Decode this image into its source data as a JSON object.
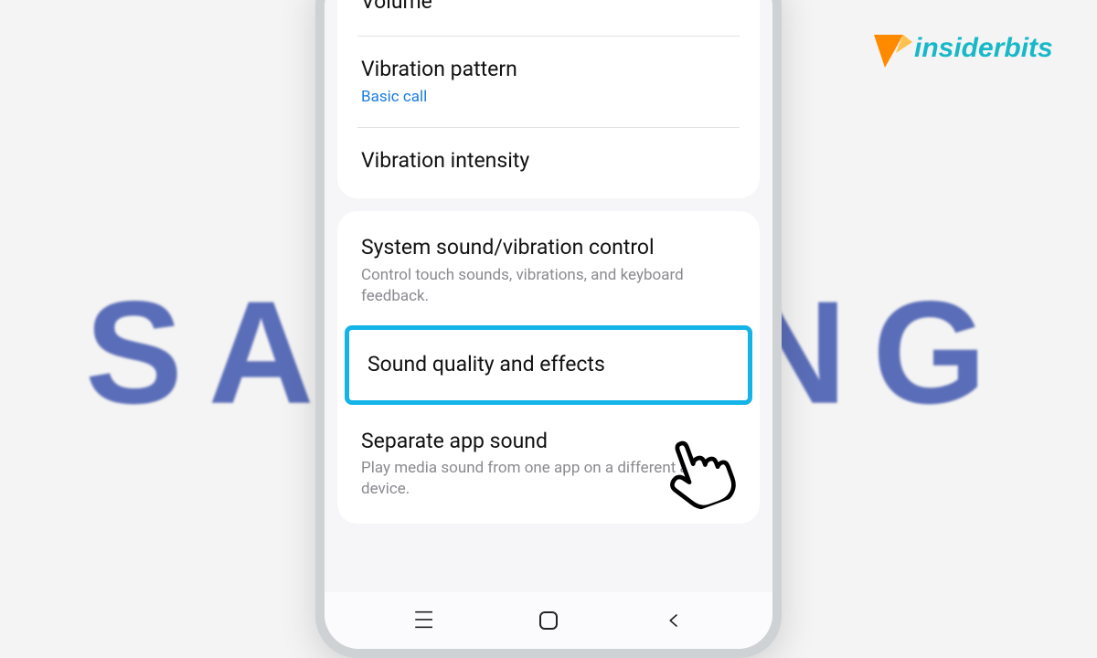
{
  "background": {
    "brand_text": "SAMSUNG"
  },
  "watermark": {
    "name": "insiderbits"
  },
  "settings": {
    "group1": {
      "volume": {
        "title": "Volume"
      },
      "vibration_pattern": {
        "title": "Vibration pattern",
        "subtitle": "Basic call"
      },
      "vibration_intensity": {
        "title": "Vibration intensity"
      }
    },
    "group2": {
      "system_sound": {
        "title": "System sound/vibration control",
        "subtitle": "Control touch sounds, vibrations, and keyboard feedback."
      },
      "sound_quality": {
        "title": "Sound quality and effects"
      },
      "separate_app": {
        "title": "Separate app sound",
        "subtitle": "Play media sound from one app on a different audio device."
      }
    }
  },
  "highlight_color": "#14b4e8"
}
